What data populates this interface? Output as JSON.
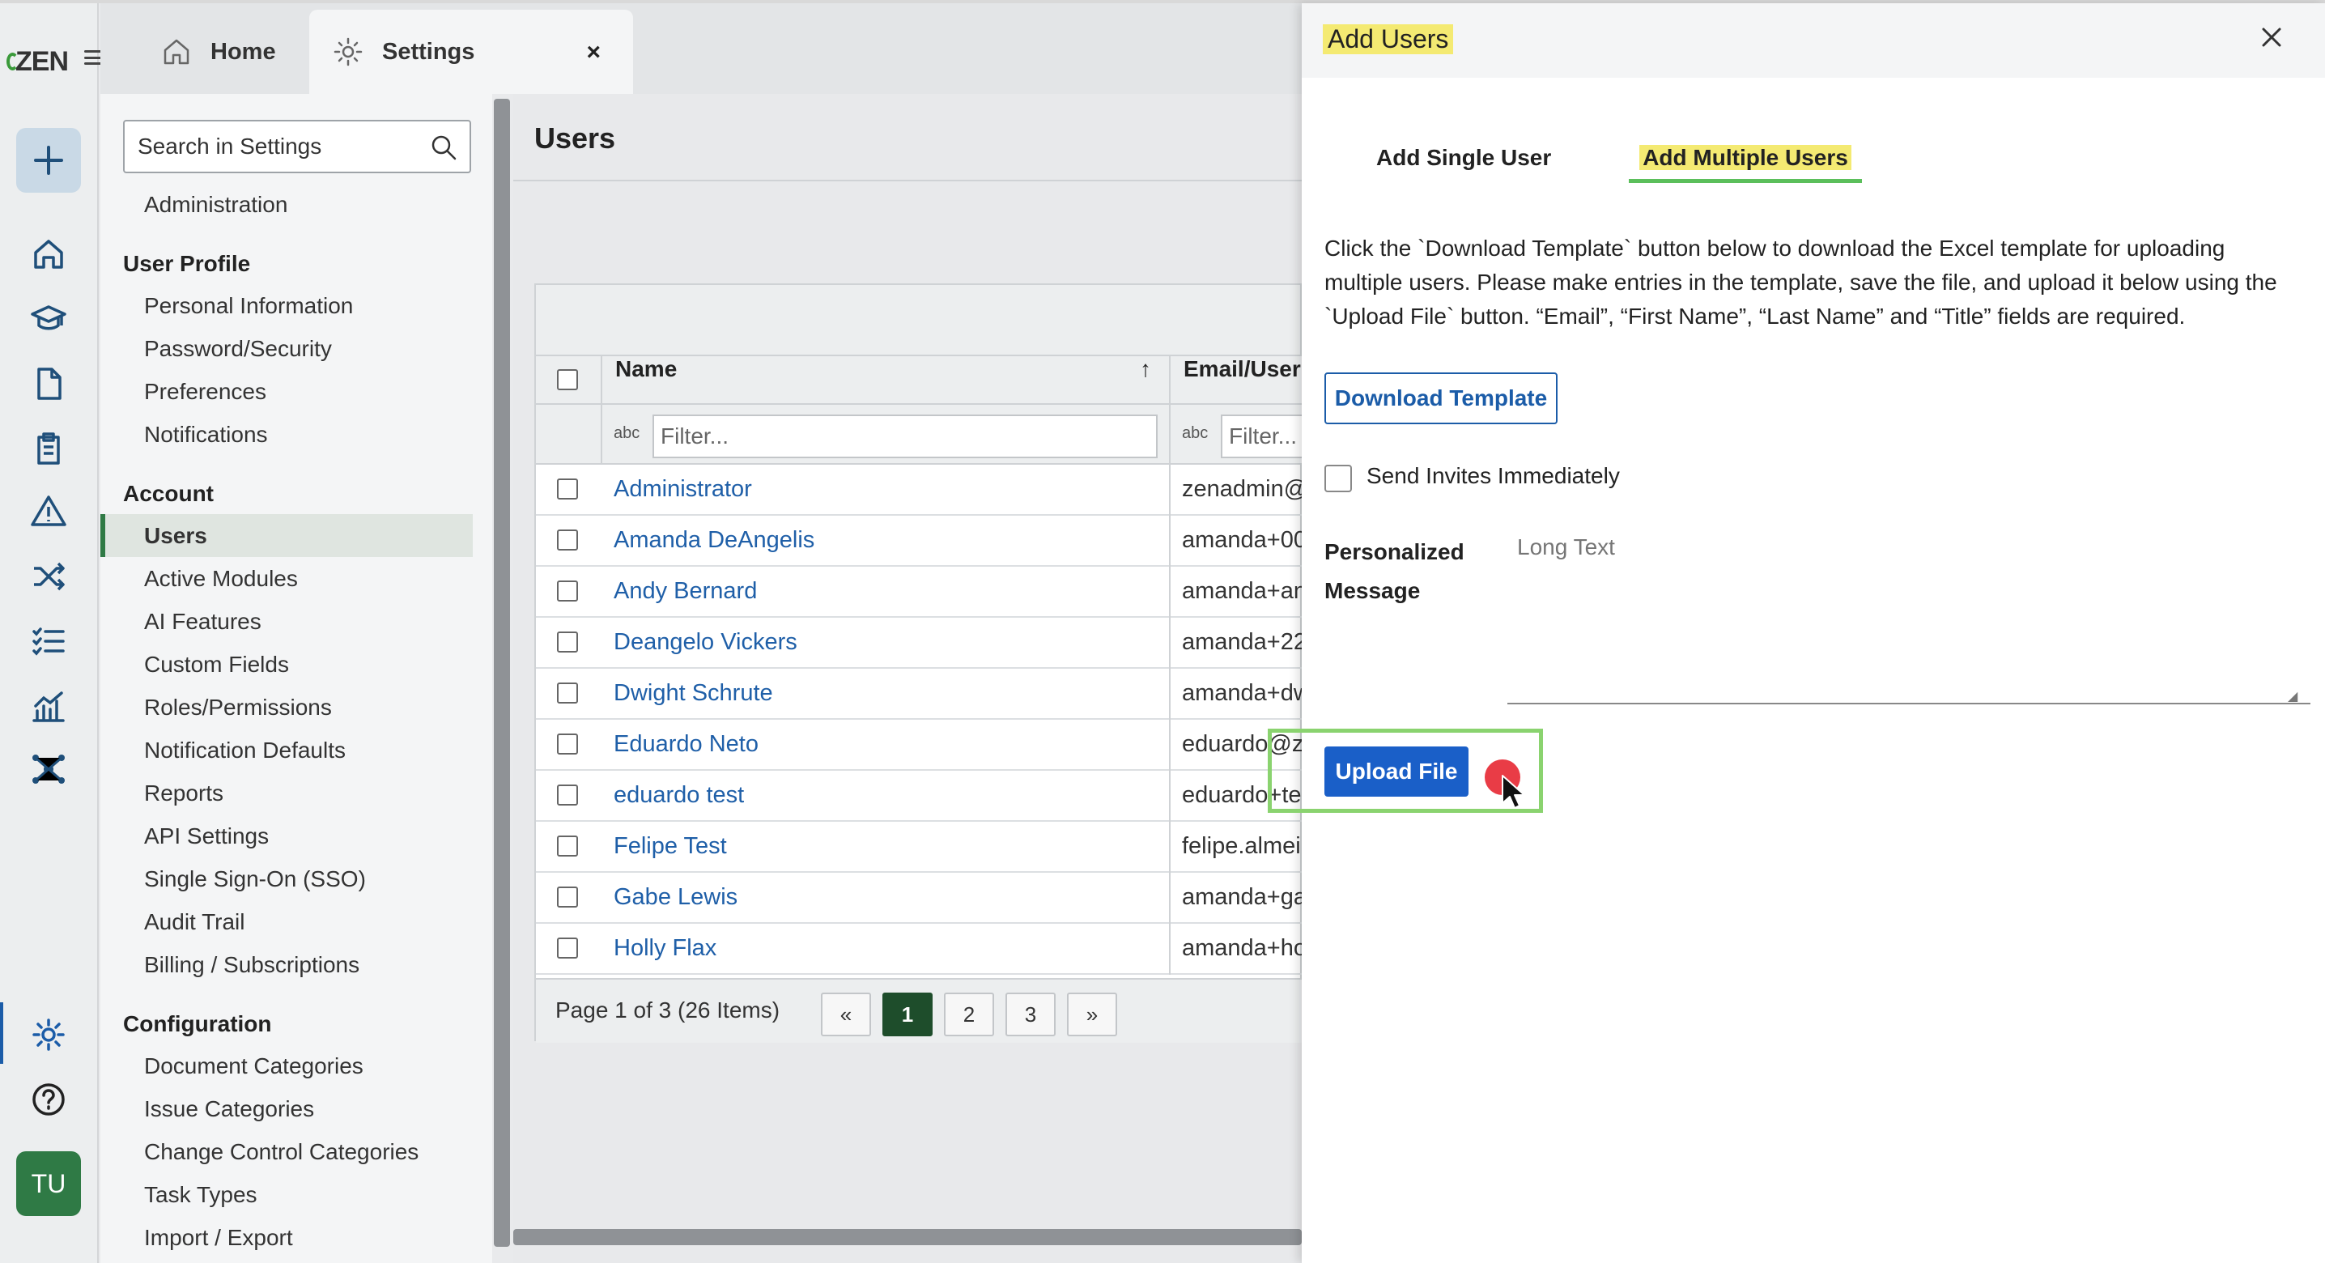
{
  "app": {
    "logo_text": "ZEN",
    "avatar_initials": "TU",
    "accent_color": "#2f7a45",
    "highlight_color": "#f4ea72"
  },
  "tabs": [
    {
      "label": "Home",
      "icon": "home-icon"
    },
    {
      "label": "Settings",
      "icon": "gear-icon",
      "close": "×"
    }
  ],
  "rail_icons": [
    "plus-icon",
    "home-icon",
    "graduation-cap-icon",
    "document-icon",
    "clipboard-icon",
    "warning-icon",
    "shuffle-icon",
    "checklist-icon",
    "chart-icon",
    "network-icon",
    "gear-icon",
    "help-icon"
  ],
  "settings_nav": {
    "search_placeholder": "Search in Settings",
    "admin_item": "Administration",
    "user_profile": {
      "heading": "User Profile",
      "items": [
        "Personal Information",
        "Password/Security",
        "Preferences",
        "Notifications"
      ]
    },
    "account": {
      "heading": "Account",
      "items": [
        "Users",
        "Active Modules",
        "AI Features",
        "Custom Fields",
        "Roles/Permissions",
        "Notification Defaults",
        "Reports",
        "API Settings",
        "Single Sign-On (SSO)",
        "Audit Trail",
        "Billing / Subscriptions"
      ]
    },
    "configuration": {
      "heading": "Configuration",
      "items": [
        "Document Categories",
        "Issue Categories",
        "Change Control Categories",
        "Task Types",
        "Import / Export"
      ]
    }
  },
  "main": {
    "title": "Users",
    "columns": {
      "name": "Name",
      "email": "Email/UserI",
      "sort_indicator": "↑"
    },
    "filter_placeholder": "Filter...",
    "filter_icon_text": "abc",
    "rows": [
      {
        "name": "Administrator",
        "email": "zenadmin@"
      },
      {
        "name": "Amanda DeAngelis",
        "email": "amanda+00"
      },
      {
        "name": "Andy Bernard",
        "email": "amanda+an"
      },
      {
        "name": "Deangelo Vickers",
        "email": "amanda+22"
      },
      {
        "name": "Dwight Schrute",
        "email": "amanda+dw"
      },
      {
        "name": "Eduardo Neto",
        "email": "eduardo@ze"
      },
      {
        "name": "eduardo test",
        "email": "eduardo+te"
      },
      {
        "name": "Felipe Test",
        "email": "felipe.almei"
      },
      {
        "name": "Gabe Lewis",
        "email": "amanda+ga"
      },
      {
        "name": "Holly Flax",
        "email": "amanda+ho"
      }
    ],
    "pager": {
      "text": "Page 1 of 3 (26 Items)",
      "prev": "«",
      "pages": [
        "1",
        "2",
        "3"
      ],
      "next": "»"
    }
  },
  "drawer": {
    "title": "Add Users",
    "close": "×",
    "tab_single": "Add Single User",
    "tab_multi": "Add Multiple Users",
    "instructions": "Click the `Download Template` button below to download the Excel template for uploading multiple users. Please make entries in the template, save the file, and upload it below using the `Upload File` button. “Email”, “First Name”, “Last Name” and “Title” fields are required.",
    "download_label": "Download Template",
    "invite_label": "Send Invites Immediately",
    "invite_checked": false,
    "message_label": "Personalized Message",
    "message_placeholder": "Long Text",
    "upload_label": "Upload File"
  }
}
